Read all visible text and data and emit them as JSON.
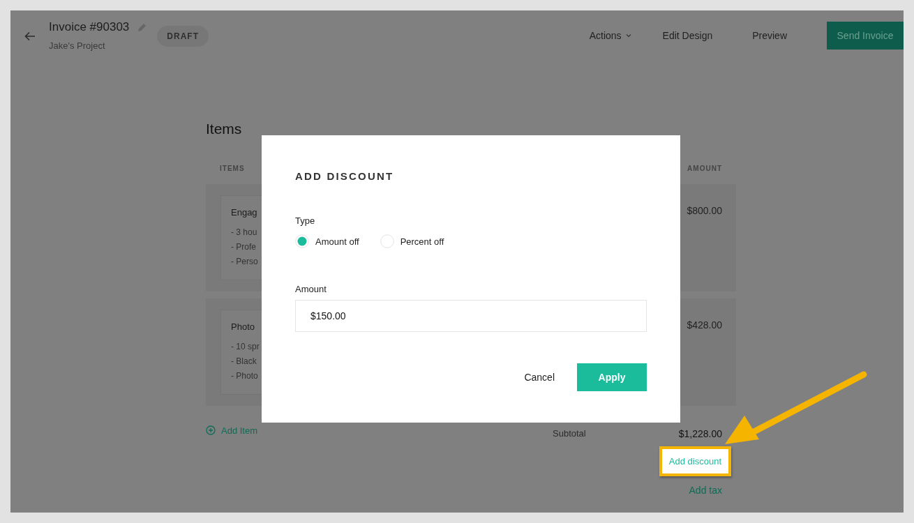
{
  "header": {
    "title": "Invoice #90303",
    "subtitle": "Jake's Project",
    "status": "DRAFT",
    "actions": [
      {
        "label": "Actions",
        "kind": "menu"
      },
      {
        "label": "Edit Design",
        "kind": "link"
      },
      {
        "label": "Preview",
        "kind": "link"
      },
      {
        "label": "Send Invoice",
        "kind": "primary"
      }
    ]
  },
  "items": {
    "heading": "Items",
    "columns": [
      "ITEMS",
      "AMOUNT"
    ],
    "rows": [
      {
        "name": "Engag",
        "lines": [
          "- 3 hou",
          "- Profe",
          "- Perso"
        ],
        "amount": "$800.00"
      },
      {
        "name": "Photo",
        "lines": [
          "- 10 spr",
          "- Black",
          "- Photo"
        ],
        "amount": "$428.00"
      }
    ],
    "add_item": "Add Item",
    "subtotal_label": "Subtotal",
    "subtotal": "$1,228.00",
    "add_discount": {
      "label": "Add discount",
      "highlighted": true
    },
    "add_tax": "Add tax"
  },
  "modal": {
    "title": "ADD DISCOUNT",
    "type_label": "Type",
    "options": [
      {
        "label": "Amount off",
        "selected": true
      },
      {
        "label": "Percent off",
        "selected": false
      }
    ],
    "amount_label": "Amount",
    "amount_value": "$150.00",
    "buttons": [
      {
        "label": "Cancel",
        "kind": "secondary"
      },
      {
        "label": "Apply",
        "kind": "primary"
      }
    ]
  }
}
